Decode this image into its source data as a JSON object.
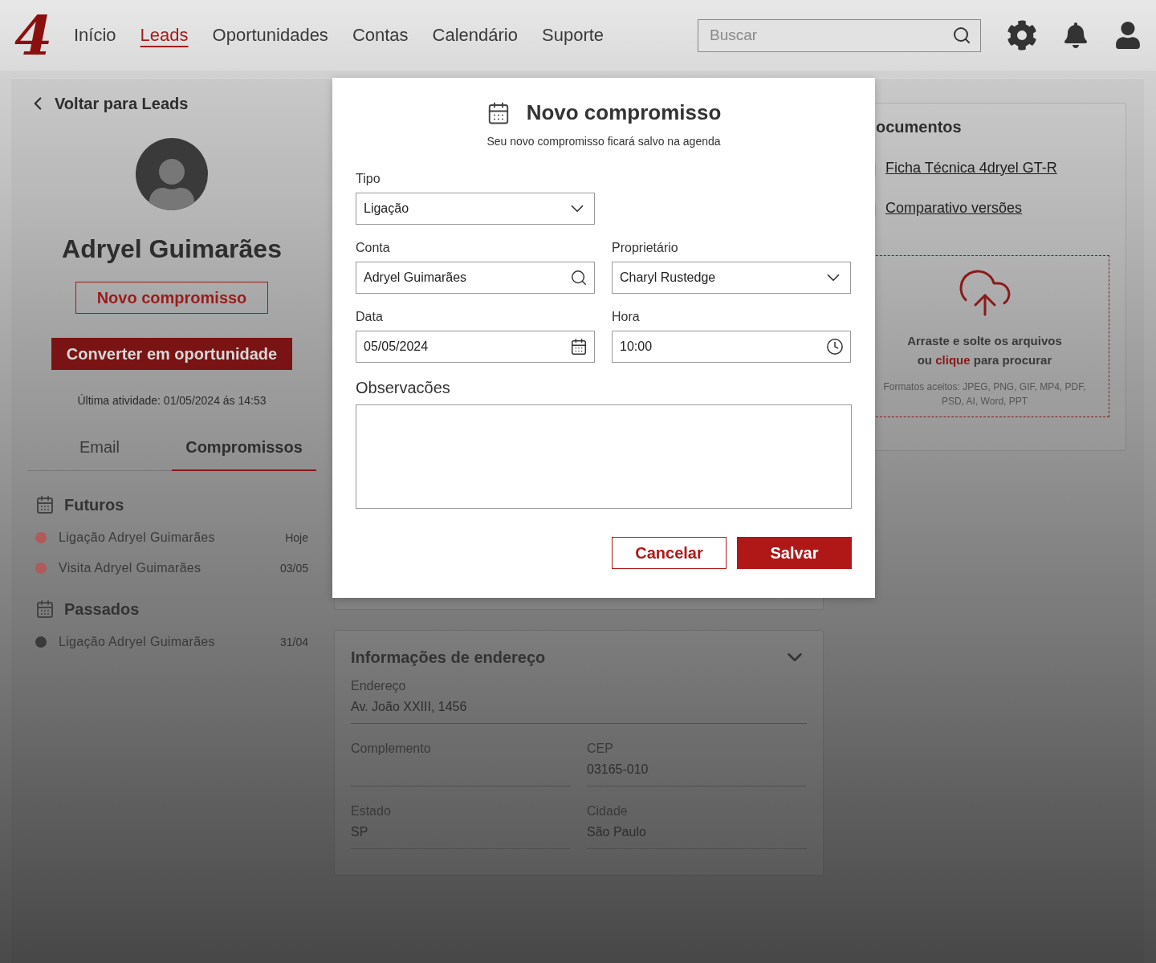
{
  "header": {
    "logo": "4",
    "nav": [
      {
        "label": "Início",
        "selected": false
      },
      {
        "label": "Leads",
        "selected": true
      },
      {
        "label": "Oportunidades",
        "selected": false
      },
      {
        "label": "Contas",
        "selected": false
      },
      {
        "label": "Calendário",
        "selected": false
      },
      {
        "label": "Suporte",
        "selected": false
      }
    ],
    "search": {
      "placeholder": "Buscar"
    }
  },
  "lead": {
    "back": "Voltar para Leads",
    "name": "Adryel Guimarães",
    "new_button": "Novo compromisso",
    "convert_button": "Converter em oportunidade",
    "last_activity": "Última atividade: 01/05/2024 ás 14:53",
    "tabs": [
      {
        "label": "Email",
        "selected": false
      },
      {
        "label": "Compromissos",
        "selected": true
      }
    ],
    "groups": [
      {
        "title": "Futuros",
        "items": [
          {
            "label": "Ligação Adryel Guimarães",
            "date": "Hoje",
            "color": "#b05a5a"
          },
          {
            "label": "Visita Adryel Guimarães",
            "date": "03/05",
            "color": "#b05a5a"
          }
        ]
      },
      {
        "title": "Passados",
        "items": [
          {
            "label": "Ligação Adryel Guimarães",
            "date": "31/04",
            "color": "#3a3a3a"
          }
        ]
      }
    ]
  },
  "documents": {
    "title": "ocumentos",
    "files": [
      "Ficha Técnica 4dryel GT-R",
      "Comparativo versões"
    ],
    "upload": {
      "prompt": "Arraste e solte os arquivos",
      "before": "ou",
      "link": "clique",
      "after": "para procurar",
      "formats": "Formatos aceitos: JPEG, PNG, GIF, MP4, PDF, PSD, AI, Word, PPT"
    }
  },
  "address": {
    "title": "Informações de endereço",
    "fields": [
      {
        "label": "Endereço",
        "value": "Av. João XXIII, 1456"
      },
      {
        "label": "Complemento"
      },
      {
        "label": "CEP",
        "value": "03165-010"
      },
      {
        "label": "Estado",
        "value": "SP"
      },
      {
        "label": "Cidade",
        "value": "São Paulo"
      }
    ]
  },
  "modal": {
    "title": "Novo compromisso",
    "subtitle": "Seu novo compromisso ficará salvo na agenda",
    "fields": [
      {
        "kind": "select",
        "label": "Tipo",
        "value": "Ligação"
      },
      {
        "kind": "spacer"
      },
      {
        "kind": "search",
        "label": "Conta",
        "value": "Adryel Guimarães"
      },
      {
        "kind": "select",
        "label": "Proprietário",
        "value": "Charyl Rustedge"
      },
      {
        "kind": "date",
        "label": "Data",
        "value": "05/05/2024"
      },
      {
        "kind": "time",
        "label": "Hora",
        "value": "10:00"
      }
    ],
    "notes_label": "Observacões",
    "cancel": "Cancelar",
    "save": "Salvar"
  }
}
